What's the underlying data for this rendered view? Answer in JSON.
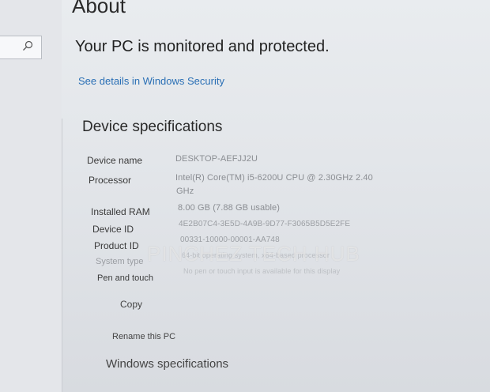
{
  "sidebar": {
    "search_icon": "search-icon"
  },
  "page": {
    "title": "About",
    "protection_status": "Your PC is monitored and protected.",
    "security_link": "See details in Windows Security"
  },
  "device_specifications": {
    "heading": "Device specifications",
    "rows": [
      {
        "label": "Device name",
        "value": "DESKTOP-AEFJJ2U"
      },
      {
        "label": "Processor",
        "value": "Intel(R) Core(TM) i5-6200U CPU @ 2.30GHz   2.40",
        "value_cont": "GHz"
      },
      {
        "label": "Installed RAM",
        "value": "8.00 GB (7.88 GB usable)"
      },
      {
        "label": "Device ID",
        "value": "4E2B07C4-3E5D-4A9B-9D77-F3065B5D5E2FE"
      },
      {
        "label": "Product ID",
        "value": "00331-10000-00001-AA748"
      },
      {
        "label": "System type",
        "value": "64-bit operating system, x64-based processor"
      },
      {
        "label": "Pen and touch",
        "value": "No pen or touch input is available for this display"
      }
    ],
    "copy_button": "Copy",
    "rename_button": "Rename this PC"
  },
  "windows_specifications": {
    "heading": "Windows specifications"
  },
  "watermark": "PINCHEZ TECH HUB"
}
